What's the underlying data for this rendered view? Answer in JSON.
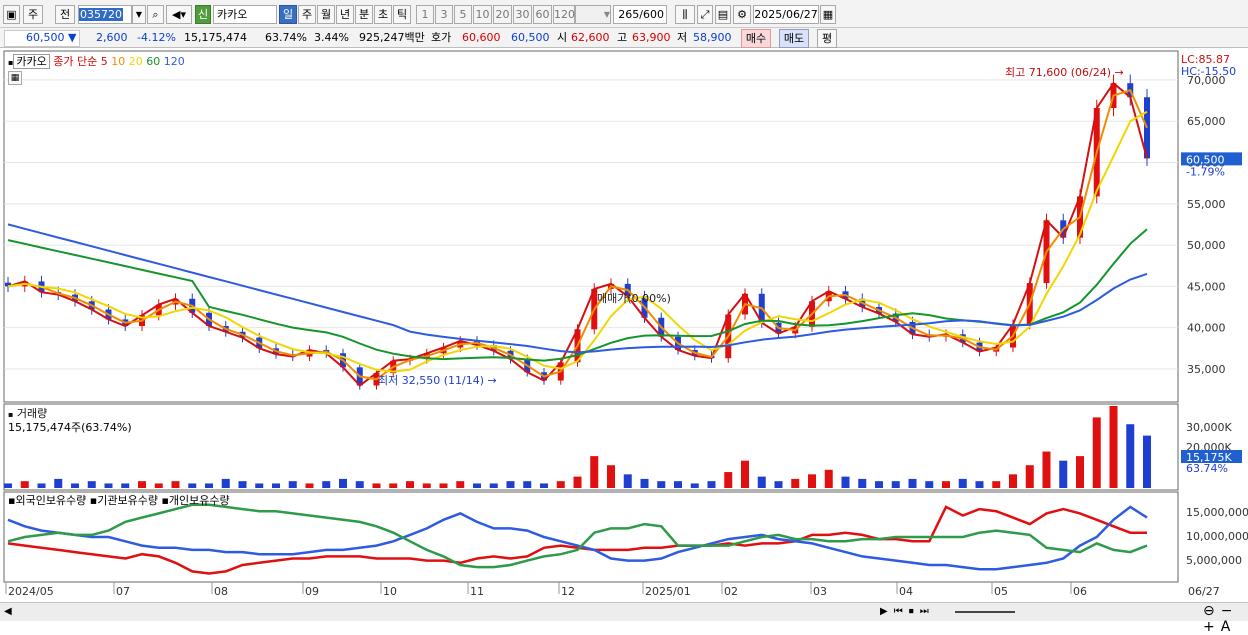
{
  "toolbar": {
    "code": "035720",
    "name": "카카오",
    "badge": "신",
    "period_buttons": [
      "일",
      "주",
      "월",
      "년",
      "분",
      "초",
      "틱"
    ],
    "numbers": [
      "1",
      "3",
      "5",
      "10",
      "20",
      "30",
      "60",
      "120"
    ],
    "count": "265",
    "count_total": "/600",
    "date": "2025/06/27",
    "left_buttons": [
      "주",
      "전"
    ]
  },
  "quote": {
    "price": "60,500",
    "arrow": "▼",
    "change": "2,600",
    "change_pct": "-4.12%",
    "volume": "15,175,474",
    "vol_ratio": "63.74%",
    "turnover": "3.44%",
    "amount": "925,247백만",
    "hoga_label": "호가",
    "ask": "60,600",
    "bid": "60,500",
    "open_label": "시",
    "open": "62,600",
    "high_label": "고",
    "high": "63,900",
    "low_label": "저",
    "low": "58,900",
    "buy": "매수",
    "sell": "매도",
    "eval": "평"
  },
  "price_panel": {
    "stock": "카카오",
    "legend_title": "종가 단순",
    "ma": [
      {
        "p": "5",
        "color": "#d41010"
      },
      {
        "p": "10",
        "color": "#f08c00"
      },
      {
        "p": "20",
        "color": "#f2d600"
      },
      {
        "p": "60",
        "color": "#15952b"
      },
      {
        "p": "120",
        "color": "#2e5be0"
      }
    ],
    "lc": "LC:85.87",
    "hc": "HC:-15.50",
    "hi_label": "최고 71,600 (06/24)",
    "lo_label": "최저 32,550 (11/14)",
    "mid_label": "매매가(0.00%)",
    "cur_price": "60,500",
    "cur_pct": "-1.79%",
    "yticks": [
      "70,000",
      "65,000",
      "60,000",
      "55,000",
      "50,000",
      "45,000",
      "40,000",
      "35,000"
    ]
  },
  "volume_panel": {
    "title": "거래량",
    "value": "15,175,474주(63.74%)",
    "cur": "15,175K",
    "cur_pct": "63.74%",
    "yticks": [
      "30,000K",
      "20,000K"
    ]
  },
  "holdings_panel": {
    "legend": [
      "외국인보유수량",
      "기관보유수량",
      "개인보유수량"
    ],
    "colors": [
      "#e01010",
      "#2e5be0",
      "#2e9a4a"
    ],
    "yticks": [
      "15,000,000",
      "10,000,000",
      "5,000,000"
    ]
  },
  "xaxis": {
    "labels": [
      "2024/05",
      "07",
      "08",
      "09",
      "10",
      "11",
      "12",
      "2025/01",
      "02",
      "03",
      "04",
      "05",
      "06"
    ],
    "end": "06/27"
  },
  "chart_data": {
    "type": "candlestick",
    "ylim": [
      31000,
      73500
    ],
    "start_date": "2024/05",
    "series_close": [
      [
        45000,
        45600,
        44300,
        44000,
        43200,
        42200,
        41000,
        40200,
        41500,
        42800,
        43500,
        41800,
        40200,
        39500,
        38800,
        37500,
        36800,
        36500,
        37300,
        36900,
        35200,
        33000,
        34500,
        36000,
        36200,
        36900,
        37600,
        38400,
        37900,
        37200,
        36200,
        34600,
        33600,
        35800,
        39800,
        44700,
        45300,
        43800,
        41200,
        38900,
        37300,
        36600,
        36300,
        41600,
        44100,
        40600,
        39300,
        40100,
        43200,
        44400,
        43500,
        42500,
        41700,
        40700,
        39200,
        38900,
        39200,
        38200,
        37100,
        37600,
        40400,
        45400,
        53000,
        50900,
        55900,
        66600,
        69600,
        67900,
        60500
      ]
    ]
  }
}
